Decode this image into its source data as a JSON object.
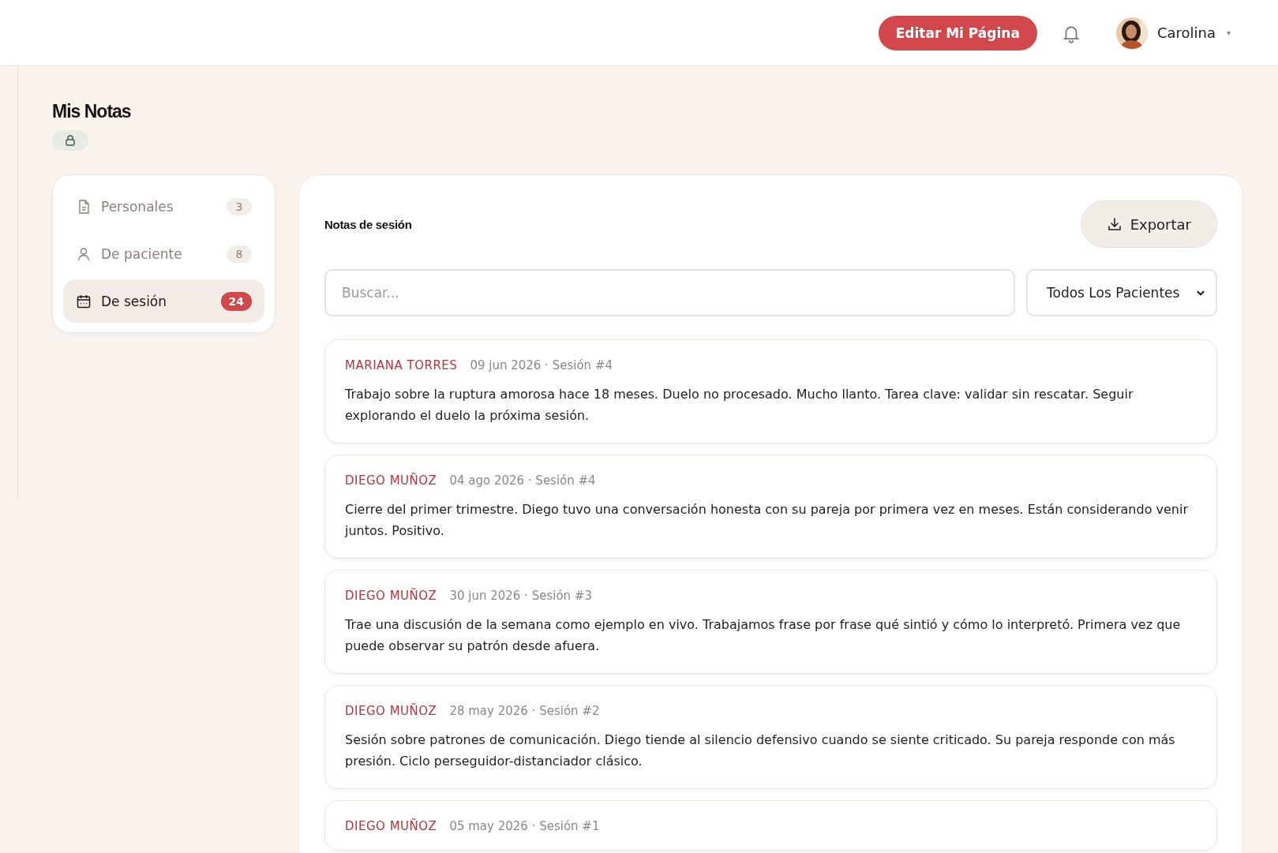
{
  "header": {
    "edit_button": "Editar Mi Página",
    "user": {
      "name": "Carolina",
      "caret": "▾"
    }
  },
  "page": {
    "title": "Mis Notas",
    "private": true
  },
  "sidebar": {
    "items": [
      {
        "label": "Personales",
        "count": "3",
        "selected": false
      },
      {
        "label": "De paciente",
        "count": "8",
        "selected": false
      },
      {
        "label": "De sesión",
        "count": "24",
        "selected": true
      }
    ]
  },
  "panel": {
    "title": "Notas de sesión",
    "export_button": "Exportar",
    "search": {
      "placeholder": "Buscar..."
    },
    "filter": {
      "value": "Todos Los Pacientes"
    },
    "notes": [
      {
        "patient": "MARIANA TORRES",
        "meta": "09 jun 2026 · Sesión #4",
        "text": "Trabajo sobre la ruptura amorosa hace 18 meses. Duelo no procesado. Mucho llanto. Tarea clave: validar sin rescatar. Seguir explorando el duelo la próxima sesión."
      },
      {
        "patient": "DIEGO MUÑOZ",
        "meta": "04 ago 2026 · Sesión #4",
        "text": "Cierre del primer trimestre. Diego tuvo una conversación honesta con su pareja por primera vez en meses. Están considerando venir juntos. Positivo."
      },
      {
        "patient": "DIEGO MUÑOZ",
        "meta": "30 jun 2026 · Sesión #3",
        "text": "Trae una discusión de la semana como ejemplo en vivo. Trabajamos frase por frase qué sintió y cómo lo interpretó. Primera vez que puede observar su patrón desde afuera."
      },
      {
        "patient": "DIEGO MUÑOZ",
        "meta": "28 may 2026 · Sesión #2",
        "text": "Sesión sobre patrones de comunicación. Diego tiende al silencio defensivo cuando se siente criticado. Su pareja responde con más presión. Ciclo perseguidor-distanciador clásico."
      },
      {
        "patient": "DIEGO MUÑOZ",
        "meta": "05 may 2026 · Sesión #1"
      }
    ]
  }
}
